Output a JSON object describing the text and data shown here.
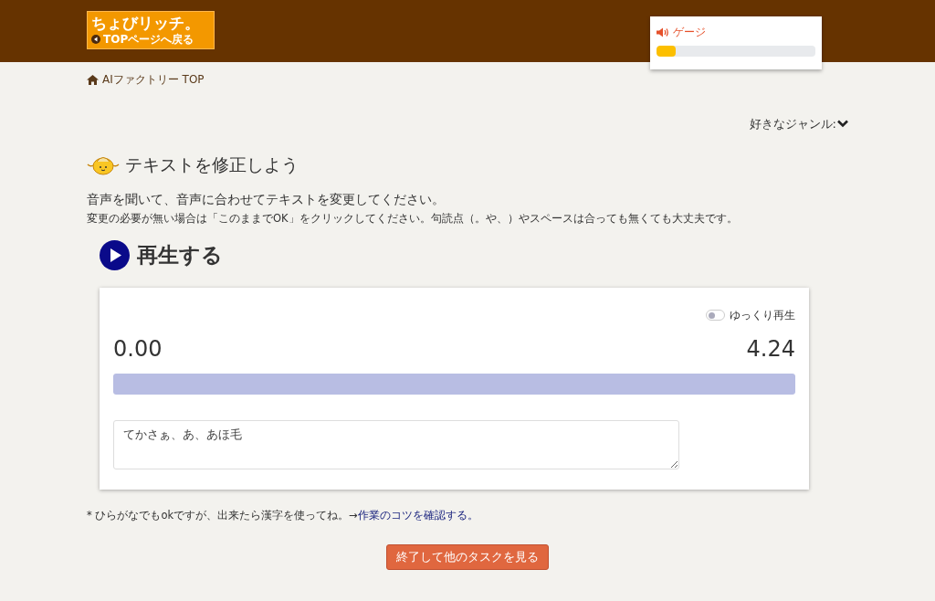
{
  "header": {
    "logo_title": "ちょびリッチ。",
    "logo_back": "TOPページへ戻る"
  },
  "gauge": {
    "label": "ゲージ",
    "level": 0.12
  },
  "breadcrumb": "AIファクトリー TOP",
  "genre_menu": {
    "label": "好きなジャンル:",
    "expanded": false
  },
  "title": "テキストを修正しよう",
  "instruction": "音声を聞いて、音声に合わせてテキストを変更してください。",
  "note": "変更の必要が無い場合は「このままでOK」をクリックしてください。句読点（。や、）やスペースは合っても無くても大丈夫です。",
  "play_button": "再生する",
  "player": {
    "slow_playback": {
      "label": "ゆっくり再生",
      "on": false
    },
    "time_start": "0.00",
    "time_end": "4.24",
    "level": 1,
    "answer": "てかさぁ、あ、あほ毛"
  },
  "footnote": {
    "text": "* ひらがなでもokですが、出来たら漢字を使ってね。→",
    "link": "作業のコツを確認する。"
  },
  "finish_button": "終了して他のタスクを見る"
}
